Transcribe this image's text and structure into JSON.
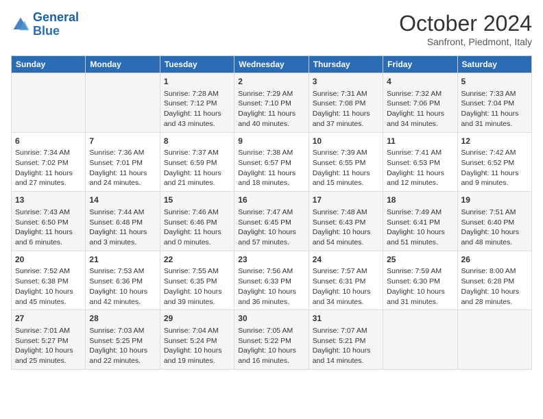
{
  "header": {
    "logo_line1": "General",
    "logo_line2": "Blue",
    "month_year": "October 2024",
    "location": "Sanfront, Piedmont, Italy"
  },
  "days_of_week": [
    "Sunday",
    "Monday",
    "Tuesday",
    "Wednesday",
    "Thursday",
    "Friday",
    "Saturday"
  ],
  "weeks": [
    [
      {
        "day": "",
        "content": ""
      },
      {
        "day": "",
        "content": ""
      },
      {
        "day": "1",
        "content": "Sunrise: 7:28 AM\nSunset: 7:12 PM\nDaylight: 11 hours and 43 minutes."
      },
      {
        "day": "2",
        "content": "Sunrise: 7:29 AM\nSunset: 7:10 PM\nDaylight: 11 hours and 40 minutes."
      },
      {
        "day": "3",
        "content": "Sunrise: 7:31 AM\nSunset: 7:08 PM\nDaylight: 11 hours and 37 minutes."
      },
      {
        "day": "4",
        "content": "Sunrise: 7:32 AM\nSunset: 7:06 PM\nDaylight: 11 hours and 34 minutes."
      },
      {
        "day": "5",
        "content": "Sunrise: 7:33 AM\nSunset: 7:04 PM\nDaylight: 11 hours and 31 minutes."
      }
    ],
    [
      {
        "day": "6",
        "content": "Sunrise: 7:34 AM\nSunset: 7:02 PM\nDaylight: 11 hours and 27 minutes."
      },
      {
        "day": "7",
        "content": "Sunrise: 7:36 AM\nSunset: 7:01 PM\nDaylight: 11 hours and 24 minutes."
      },
      {
        "day": "8",
        "content": "Sunrise: 7:37 AM\nSunset: 6:59 PM\nDaylight: 11 hours and 21 minutes."
      },
      {
        "day": "9",
        "content": "Sunrise: 7:38 AM\nSunset: 6:57 PM\nDaylight: 11 hours and 18 minutes."
      },
      {
        "day": "10",
        "content": "Sunrise: 7:39 AM\nSunset: 6:55 PM\nDaylight: 11 hours and 15 minutes."
      },
      {
        "day": "11",
        "content": "Sunrise: 7:41 AM\nSunset: 6:53 PM\nDaylight: 11 hours and 12 minutes."
      },
      {
        "day": "12",
        "content": "Sunrise: 7:42 AM\nSunset: 6:52 PM\nDaylight: 11 hours and 9 minutes."
      }
    ],
    [
      {
        "day": "13",
        "content": "Sunrise: 7:43 AM\nSunset: 6:50 PM\nDaylight: 11 hours and 6 minutes."
      },
      {
        "day": "14",
        "content": "Sunrise: 7:44 AM\nSunset: 6:48 PM\nDaylight: 11 hours and 3 minutes."
      },
      {
        "day": "15",
        "content": "Sunrise: 7:46 AM\nSunset: 6:46 PM\nDaylight: 11 hours and 0 minutes."
      },
      {
        "day": "16",
        "content": "Sunrise: 7:47 AM\nSunset: 6:45 PM\nDaylight: 10 hours and 57 minutes."
      },
      {
        "day": "17",
        "content": "Sunrise: 7:48 AM\nSunset: 6:43 PM\nDaylight: 10 hours and 54 minutes."
      },
      {
        "day": "18",
        "content": "Sunrise: 7:49 AM\nSunset: 6:41 PM\nDaylight: 10 hours and 51 minutes."
      },
      {
        "day": "19",
        "content": "Sunrise: 7:51 AM\nSunset: 6:40 PM\nDaylight: 10 hours and 48 minutes."
      }
    ],
    [
      {
        "day": "20",
        "content": "Sunrise: 7:52 AM\nSunset: 6:38 PM\nDaylight: 10 hours and 45 minutes."
      },
      {
        "day": "21",
        "content": "Sunrise: 7:53 AM\nSunset: 6:36 PM\nDaylight: 10 hours and 42 minutes."
      },
      {
        "day": "22",
        "content": "Sunrise: 7:55 AM\nSunset: 6:35 PM\nDaylight: 10 hours and 39 minutes."
      },
      {
        "day": "23",
        "content": "Sunrise: 7:56 AM\nSunset: 6:33 PM\nDaylight: 10 hours and 36 minutes."
      },
      {
        "day": "24",
        "content": "Sunrise: 7:57 AM\nSunset: 6:31 PM\nDaylight: 10 hours and 34 minutes."
      },
      {
        "day": "25",
        "content": "Sunrise: 7:59 AM\nSunset: 6:30 PM\nDaylight: 10 hours and 31 minutes."
      },
      {
        "day": "26",
        "content": "Sunrise: 8:00 AM\nSunset: 6:28 PM\nDaylight: 10 hours and 28 minutes."
      }
    ],
    [
      {
        "day": "27",
        "content": "Sunrise: 7:01 AM\nSunset: 5:27 PM\nDaylight: 10 hours and 25 minutes."
      },
      {
        "day": "28",
        "content": "Sunrise: 7:03 AM\nSunset: 5:25 PM\nDaylight: 10 hours and 22 minutes."
      },
      {
        "day": "29",
        "content": "Sunrise: 7:04 AM\nSunset: 5:24 PM\nDaylight: 10 hours and 19 minutes."
      },
      {
        "day": "30",
        "content": "Sunrise: 7:05 AM\nSunset: 5:22 PM\nDaylight: 10 hours and 16 minutes."
      },
      {
        "day": "31",
        "content": "Sunrise: 7:07 AM\nSunset: 5:21 PM\nDaylight: 10 hours and 14 minutes."
      },
      {
        "day": "",
        "content": ""
      },
      {
        "day": "",
        "content": ""
      }
    ]
  ]
}
